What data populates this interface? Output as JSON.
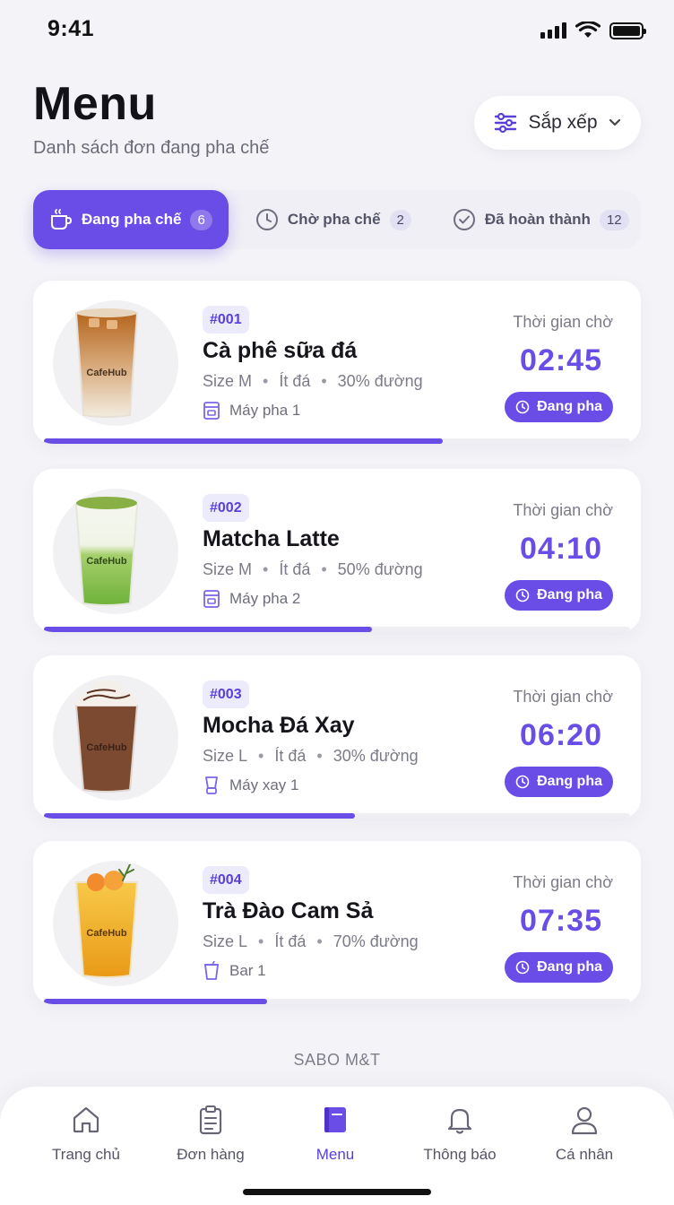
{
  "status_bar": {
    "time": "9:41"
  },
  "header": {
    "title": "Menu",
    "subtitle": "Danh sách đơn đang pha chế",
    "sort_label": "Sắp xếp"
  },
  "tabs": [
    {
      "label": "Đang pha chế",
      "count": "6",
      "active": true,
      "icon": "cup-icon"
    },
    {
      "label": "Chờ pha chế",
      "count": "2",
      "active": false,
      "icon": "clock-icon"
    },
    {
      "label": "Đã hoàn thành",
      "count": "12",
      "active": false,
      "icon": "check-circle-icon"
    }
  ],
  "orders": [
    {
      "id": "#001",
      "name": "Cà phê sữa đá",
      "size": "Size M",
      "ice": "Ít đá",
      "sugar": "30% đường",
      "machine": "Máy pha 1",
      "machine_icon": "coffee-machine-icon",
      "wait_label": "Thời gian chờ",
      "timer": "02:45",
      "status": "Đang pha",
      "progress": 0.68,
      "cup_brand": "CafeHub"
    },
    {
      "id": "#002",
      "name": "Matcha Latte",
      "size": "Size M",
      "ice": "Ít đá",
      "sugar": "50% đường",
      "machine": "Máy pha 2",
      "machine_icon": "coffee-machine-icon",
      "wait_label": "Thời gian chờ",
      "timer": "04:10",
      "status": "Đang pha",
      "progress": 0.56,
      "cup_brand": "CafeHub"
    },
    {
      "id": "#003",
      "name": "Mocha Đá Xay",
      "size": "Size L",
      "ice": "Ít đá",
      "sugar": "30% đường",
      "machine": "Máy xay 1",
      "machine_icon": "blender-icon",
      "wait_label": "Thời gian chờ",
      "timer": "06:20",
      "status": "Đang pha",
      "progress": 0.53,
      "cup_brand": "CafeHub"
    },
    {
      "id": "#004",
      "name": "Trà Đào Cam Sả",
      "size": "Size L",
      "ice": "Ít đá",
      "sugar": "70% đường",
      "machine": "Bar 1",
      "machine_icon": "cup-icon",
      "wait_label": "Thời gian chờ",
      "timer": "07:35",
      "status": "Đang pha",
      "progress": 0.38,
      "cup_brand": "CafeHub"
    }
  ],
  "footer_brand": "SABO M&T",
  "nav": [
    {
      "label": "Trang chủ",
      "icon": "home-icon",
      "active": false
    },
    {
      "label": "Đơn hàng",
      "icon": "clipboard-icon",
      "active": false
    },
    {
      "label": "Menu",
      "icon": "book-icon",
      "active": true
    },
    {
      "label": "Thông báo",
      "icon": "bell-icon",
      "active": false
    },
    {
      "label": "Cá nhân",
      "icon": "user-icon",
      "active": false
    }
  ],
  "colors": {
    "accent": "#6a4de6",
    "background": "#f4f4f8"
  }
}
